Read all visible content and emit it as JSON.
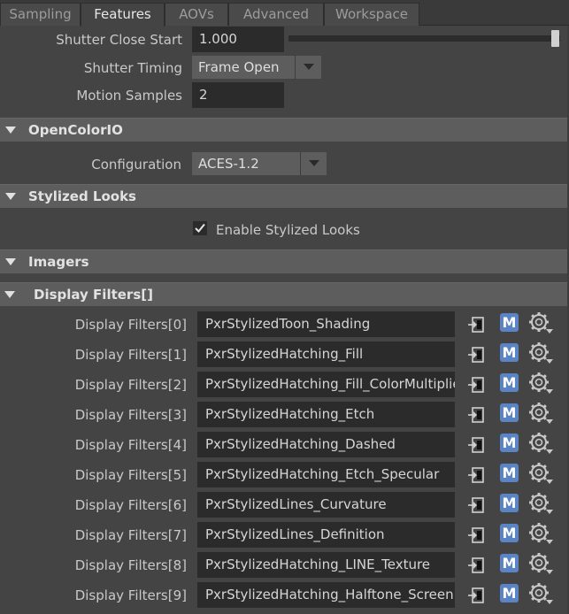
{
  "tabs": [
    "Sampling",
    "Features",
    "AOVs",
    "Advanced",
    "Workspace"
  ],
  "active_tab": "Features",
  "shutter_close_start": {
    "label": "Shutter Close Start",
    "value": "1.000",
    "slider_fraction": 1.0
  },
  "shutter_timing": {
    "label": "Shutter Timing",
    "value": "Frame Open"
  },
  "motion_samples": {
    "label": "Motion Samples",
    "value": "2"
  },
  "ocio": {
    "title": "OpenColorIO",
    "config_label": "Configuration",
    "config_value": "ACES-1.2"
  },
  "stylized": {
    "title": "Stylized Looks",
    "enable_label": "Enable Stylized Looks",
    "enabled": true
  },
  "imagers": {
    "title": "Imagers"
  },
  "display_filters": {
    "title": "Display Filters[]",
    "items": [
      {
        "label": "Display Filters[0]",
        "value": "PxrStylizedToon_Shading"
      },
      {
        "label": "Display Filters[1]",
        "value": "PxrStylizedHatching_Fill"
      },
      {
        "label": "Display Filters[2]",
        "value": "PxrStylizedHatching_Fill_ColorMultiplier"
      },
      {
        "label": "Display Filters[3]",
        "value": "PxrStylizedHatching_Etch"
      },
      {
        "label": "Display Filters[4]",
        "value": "PxrStylizedHatching_Dashed"
      },
      {
        "label": "Display Filters[5]",
        "value": "PxrStylizedHatching_Etch_Specular"
      },
      {
        "label": "Display Filters[6]",
        "value": "PxrStylizedLines_Curvature"
      },
      {
        "label": "Display Filters[7]",
        "value": "PxrStylizedLines_Definition"
      },
      {
        "label": "Display Filters[8]",
        "value": "PxrStylizedHatching_LINE_Texture"
      },
      {
        "label": "Display Filters[9]",
        "value": "PxrStylizedHatching_Halftone_Screen"
      }
    ],
    "icons": [
      "connect-input-icon",
      "maya-m-icon",
      "gear-dropdown-icon"
    ],
    "m_icon_letter": "M"
  },
  "colors": {
    "m_icon": "#5b84c4",
    "panel": "#444444",
    "section": "#5d5d5d",
    "field": "#2b2b2b"
  }
}
